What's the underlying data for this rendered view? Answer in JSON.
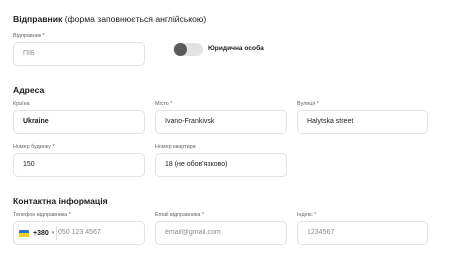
{
  "sender": {
    "title": "Відправник",
    "note": " (форма заповнюється англійською)",
    "name_label": "Відправник *",
    "name_placeholder": "ПІБ",
    "name_value": "",
    "legal_toggle_label": "Юридична особа",
    "legal_toggle_on": false
  },
  "address": {
    "title": "Адреса",
    "country_label": "Країна",
    "country_value": "Ukraine",
    "city_label": "Місто *",
    "city_value": "Ivano-Frankivsk",
    "street_label": "Вулиця *",
    "street_value": "Halytska street",
    "house_label": "Номер будинку *",
    "house_value": "150",
    "apartment_label": "Номер квартири",
    "apartment_placeholder": "18 (не обов'язково)"
  },
  "contact": {
    "title": "Контактна інформація",
    "phone_label": "Телефон відправника *",
    "dial_code": "+380",
    "phone_placeholder": "050 123 4567",
    "flag_colors": [
      "#2f6fd6",
      "#f5d21a"
    ],
    "email_label": "Email відправника *",
    "email_placeholder": "email@gmail.com",
    "zip_label": "Індекс *",
    "zip_placeholder": "1234567"
  }
}
